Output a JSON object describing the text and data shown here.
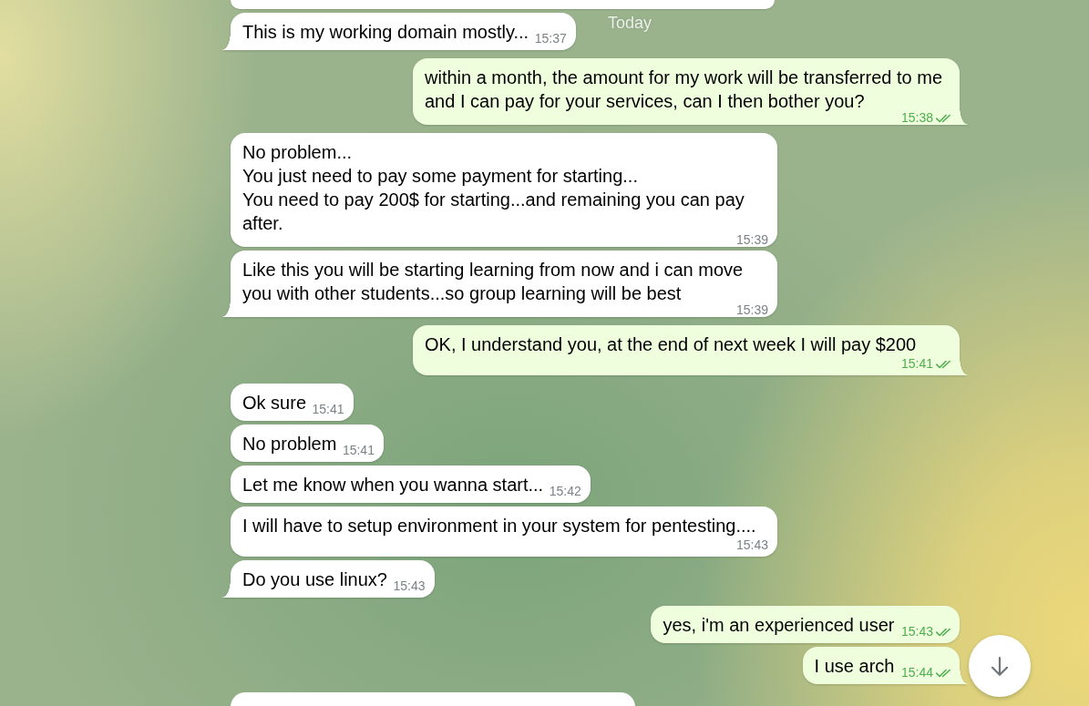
{
  "date_header": "Today",
  "clipped_above": {
    "kind": "incoming"
  },
  "messages": [
    {
      "kind": "incoming",
      "text": "This is my working domain mostly...",
      "time": "15:37"
    },
    {
      "kind": "outgoing",
      "text": "within a month, the amount for my work will be transferred to me and I can pay for your services, can I then bother you?",
      "time": "15:38",
      "read": true
    },
    {
      "kind": "incoming",
      "text": "No problem...\nYou just need to pay some payment for starting...\nYou need to pay 200$ for starting...and remaining you can pay after.",
      "time": "15:39"
    },
    {
      "kind": "incoming",
      "text": "Like this you will be starting learning from now and i can move you with other students...so group learning will be best",
      "time": "15:39"
    },
    {
      "kind": "outgoing",
      "text": "OK, I understand you, at the end of next week I will pay $200",
      "time": "15:41",
      "read": true
    },
    {
      "kind": "incoming",
      "text": "Ok sure",
      "time": "15:41"
    },
    {
      "kind": "incoming",
      "text": "No problem",
      "time": "15:41"
    },
    {
      "kind": "incoming",
      "text": "Let me know when you wanna start...",
      "time": "15:42"
    },
    {
      "kind": "incoming",
      "text": "I will have to setup environment in your system for pentesting....",
      "time": "15:43"
    },
    {
      "kind": "incoming",
      "text": "Do you use linux?",
      "time": "15:43"
    },
    {
      "kind": "outgoing",
      "text": "yes, i'm an experienced user",
      "time": "15:43",
      "read": true
    },
    {
      "kind": "outgoing",
      "text": "I use arch",
      "time": "15:44",
      "read": true
    }
  ],
  "clipped_below": {
    "kind": "incoming"
  },
  "scroll_down_button": true
}
